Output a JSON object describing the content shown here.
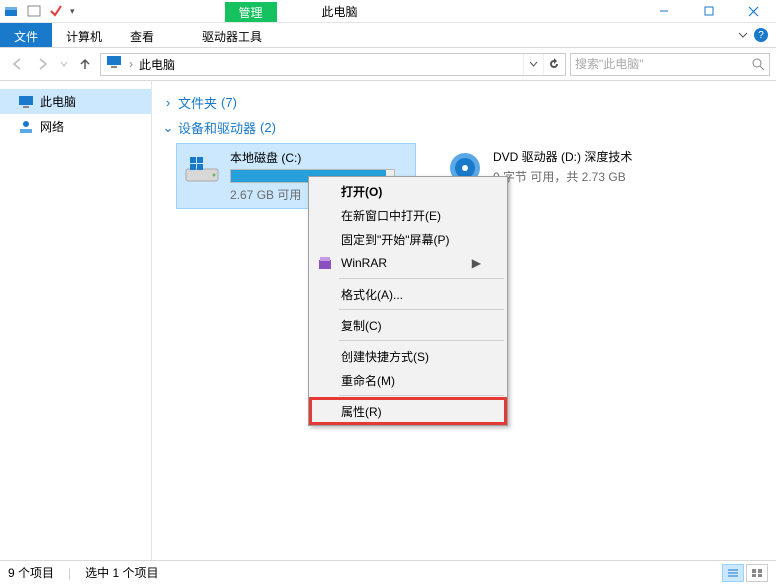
{
  "title": "此电脑",
  "toolTab": "管理",
  "ribbon": {
    "file": "文件",
    "computer": "计算机",
    "view": "查看",
    "driveTools": "驱动器工具"
  },
  "breadcrumb": {
    "root": "此电脑"
  },
  "search": {
    "placeholder": "搜索\"此电脑\""
  },
  "sidebar": {
    "thispc": "此电脑",
    "network": "网络"
  },
  "groups": {
    "folders": {
      "label": "文件夹",
      "count": "(7)"
    },
    "devices": {
      "label": "设备和驱动器",
      "count": "(2)"
    }
  },
  "drives": {
    "c": {
      "name": "本地磁盘 (C:)",
      "free": "2.67 GB 可用",
      "fillPercent": 95
    },
    "d": {
      "name": "DVD 驱动器 (D:) 深度技术",
      "free": "0 字节 可用，共 2.73 GB"
    }
  },
  "context": {
    "open": "打开(O)",
    "openNew": "在新窗口中打开(E)",
    "pinStart": "固定到\"开始\"屏幕(P)",
    "winrar": "WinRAR",
    "format": "格式化(A)...",
    "copy": "复制(C)",
    "shortcut": "创建快捷方式(S)",
    "rename": "重命名(M)",
    "properties": "属性(R)"
  },
  "status": {
    "items": "9 个项目",
    "selected": "选中 1 个项目"
  },
  "colors": {
    "accent": "#1979CA",
    "green": "#16C160",
    "selection": "#CCE8FF"
  }
}
